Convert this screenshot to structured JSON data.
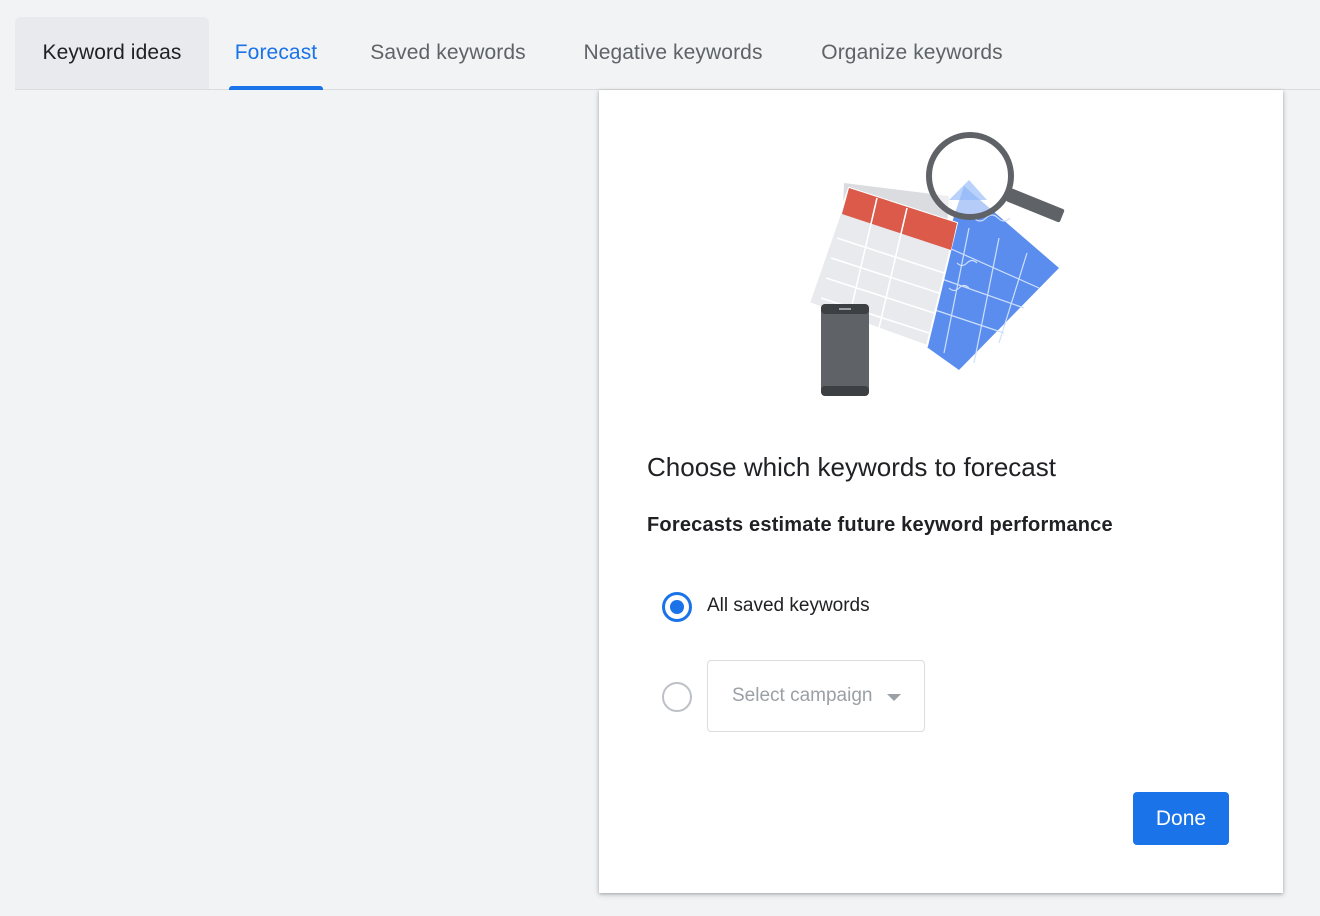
{
  "tabs": [
    {
      "label": "Keyword ideas",
      "state": "highlighted"
    },
    {
      "label": "Forecast",
      "state": "active"
    },
    {
      "label": "Saved keywords",
      "state": "default"
    },
    {
      "label": "Negative keywords",
      "state": "default"
    },
    {
      "label": "Organize keywords",
      "state": "default"
    }
  ],
  "panel": {
    "illustration_icon": "forecast-illustration",
    "heading": "Choose which keywords to forecast",
    "subheading": "Forecasts estimate future keyword performance",
    "options": [
      {
        "label": "All saved keywords",
        "checked": true
      },
      {
        "label": "",
        "checked": false
      }
    ],
    "campaign_select": {
      "placeholder": "Select campaign"
    },
    "done_label": "Done"
  },
  "colors": {
    "accent": "#1a73e8",
    "background": "#f1f3f4",
    "panel": "#ffffff",
    "muted_text": "#5f6368",
    "illustration_red": "#db5a4a",
    "illustration_blue": "#5b8def"
  }
}
